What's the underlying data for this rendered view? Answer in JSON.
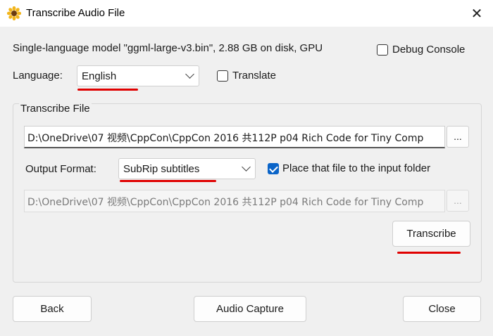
{
  "window": {
    "title": "Transcribe Audio File",
    "close_glyph": "✕"
  },
  "model_info": "Single-language model \"ggml-large-v3.bin\", 2.88 GB on disk, GPU",
  "debug_console": {
    "label": "Debug Console",
    "checked": false
  },
  "language": {
    "label": "Language:",
    "value": "English"
  },
  "translate": {
    "label": "Translate",
    "checked": false
  },
  "transcribe_group": {
    "title": "Transcribe File",
    "input_path": "D:\\OneDrive\\07 视频\\CppCon\\CppCon 2016 共112P p04 Rich Code for Tiny Comp",
    "browse_label": "...",
    "output_format_label": "Output Format:",
    "output_format_value": "SubRip subtitles",
    "place_in_input_folder": {
      "label": "Place that file to the input folder",
      "checked": true
    },
    "output_path": "D:\\OneDrive\\07 视频\\CppCon\\CppCon 2016 共112P p04 Rich Code for Tiny Comp",
    "output_browse_label": "...",
    "transcribe_button": "Transcribe"
  },
  "footer": {
    "back": "Back",
    "audio_capture": "Audio Capture",
    "close": "Close"
  },
  "colors": {
    "accent": "#0a64c8",
    "annotation": "#e00000"
  }
}
